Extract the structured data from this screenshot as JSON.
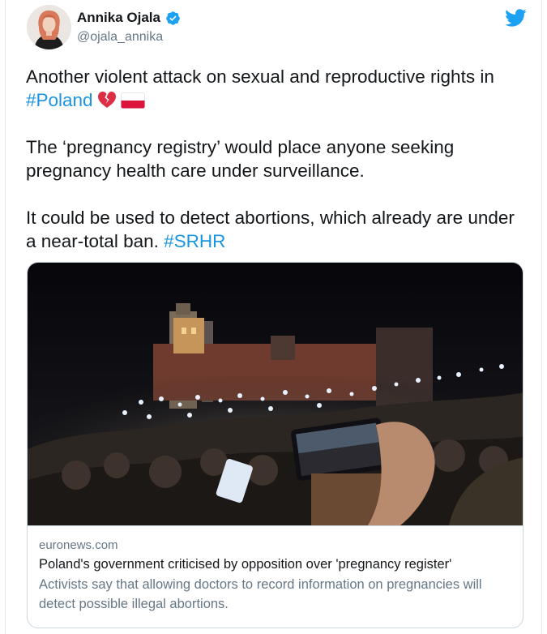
{
  "author": {
    "name": "Annika Ojala",
    "handle": "@ojala_annika",
    "verified": true
  },
  "tweet": {
    "line1_text": "Another violent attack on sexual and reproductive rights in ",
    "hashtag_poland": "#Poland",
    "emojis": [
      "broken-heart-icon",
      "poland-flag-icon"
    ],
    "paragraph2": "The ‘pregnancy registry’ would place anyone seeking pregnancy health care under surveillance.",
    "paragraph3_text": "It could be used to detect abortions, which already are under a near-total ban. ",
    "hashtag_srhr": "#SRHR"
  },
  "card": {
    "image": "night-protest-crowd-phone-lights-photo",
    "domain": "euronews.com",
    "title": "Poland's government criticised by opposition over 'pregnancy register'",
    "description": "Activists say that allowing doctors to record information on pregnancies will detect possible illegal abortions."
  },
  "colors": {
    "link": "#1b95e0",
    "twitter_blue": "#1da1f2",
    "secondary_text": "#657786",
    "border": "#ccd6dd"
  }
}
